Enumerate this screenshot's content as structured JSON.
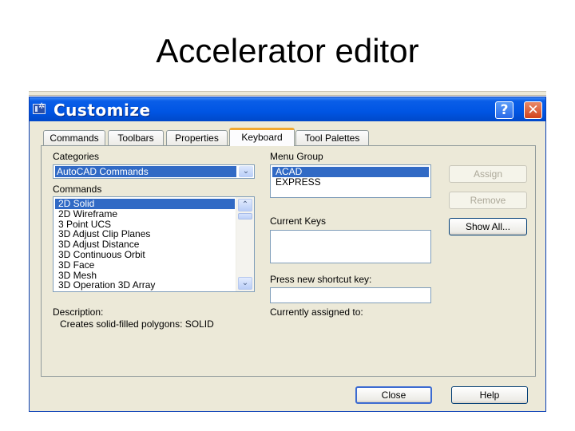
{
  "slide": {
    "title": "Accelerator editor"
  },
  "window": {
    "title": "Customize",
    "help_button": "?",
    "close_button": "✕"
  },
  "tabs": [
    {
      "label": "Commands",
      "active": false
    },
    {
      "label": "Toolbars",
      "active": false
    },
    {
      "label": "Properties",
      "active": false
    },
    {
      "label": "Keyboard",
      "active": true
    },
    {
      "label": "Tool Palettes",
      "active": false
    }
  ],
  "keyboard": {
    "categories_label": "Categories",
    "categories_value": "AutoCAD Commands",
    "commands_label": "Commands",
    "commands": [
      "2D Solid",
      "2D Wireframe",
      "3 Point UCS",
      "3D Adjust Clip Planes",
      "3D Adjust Distance",
      "3D Continuous Orbit",
      "3D Face",
      "3D Mesh",
      "3D Operation 3D Array"
    ],
    "selected_command": "2D Solid",
    "description_label": "Description:",
    "description_text": "Creates solid-filled polygons:  SOLID",
    "menu_group_label": "Menu Group",
    "menu_groups": [
      "ACAD",
      "EXPRESS"
    ],
    "selected_menu_group": "ACAD",
    "current_keys_label": "Current Keys",
    "current_keys": [],
    "shortcut_label": "Press new shortcut key:",
    "shortcut_value": "",
    "assigned_label": "Currently assigned to:",
    "assigned_value": ""
  },
  "buttons": {
    "assign": "Assign",
    "remove": "Remove",
    "show_all": "Show All...",
    "close": "Close",
    "help": "Help"
  },
  "icons": {
    "scroll_up": "⌃",
    "scroll_down": "⌄",
    "dropdown": "⌄"
  }
}
